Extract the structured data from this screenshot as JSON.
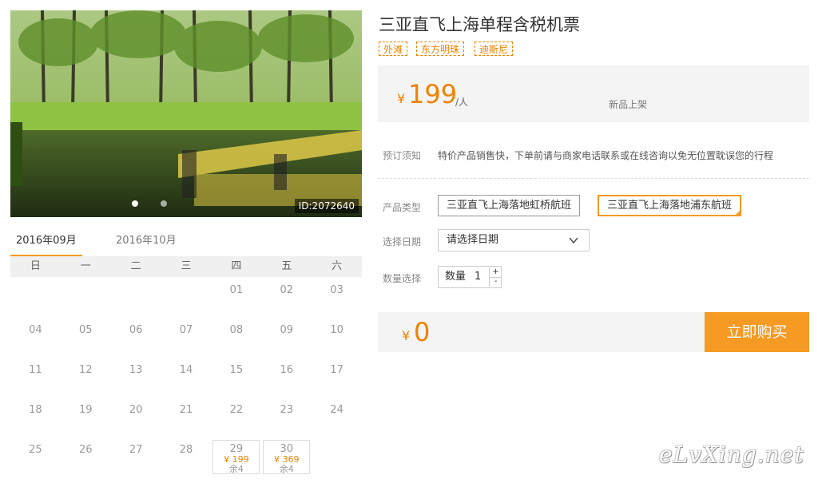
{
  "product": {
    "title": "三亚直飞上海单程含税机票",
    "tags": [
      "外滩",
      "东方明珠",
      "迪斯尼"
    ],
    "photo_id": "ID:2072640",
    "price_symbol": "¥",
    "price": "199",
    "price_unit": "/人",
    "price_note": "新品上架"
  },
  "notice": {
    "label": "预订须知",
    "text": "特价产品销售快，下单前请与商家电话联系或在线咨询以免无位置耽误您的行程"
  },
  "product_type": {
    "label": "产品类型",
    "options": [
      "三亚直飞上海落地虹桥航班",
      "三亚直飞上海落地浦东航班"
    ],
    "selected": 1
  },
  "date_select": {
    "label": "选择日期",
    "value": "请选择日期"
  },
  "quantity": {
    "label": "数量选择",
    "field_label": "数量",
    "value": "1",
    "plus": "+",
    "minus": "-"
  },
  "total": {
    "symbol": "¥",
    "value": "0"
  },
  "buy_button": "立即购买",
  "calendar": {
    "months": [
      "2016年09月",
      "2016年10月"
    ],
    "active_month": 0,
    "weekdays": [
      "日",
      "一",
      "二",
      "三",
      "四",
      "五",
      "六"
    ],
    "weeks": [
      [
        "",
        "",
        "",
        "",
        "01",
        "02",
        "03"
      ],
      [
        "04",
        "05",
        "06",
        "07",
        "08",
        "09",
        "10"
      ],
      [
        "11",
        "12",
        "13",
        "14",
        "15",
        "16",
        "17"
      ],
      [
        "18",
        "19",
        "20",
        "21",
        "22",
        "23",
        "24"
      ],
      [
        "25",
        "26",
        "27",
        "28",
        "29",
        "30",
        ""
      ]
    ],
    "available": {
      "29": {
        "price": "¥ 199",
        "stock": "余4"
      },
      "30": {
        "price": "¥ 369",
        "stock": "余4"
      }
    }
  },
  "watermark": "eLvXing.net",
  "colors": {
    "accent": "#f59a23",
    "price": "#f08200"
  }
}
